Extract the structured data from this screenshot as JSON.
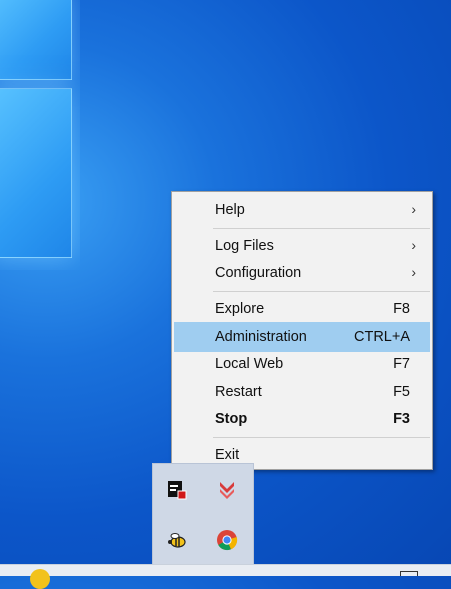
{
  "menu": {
    "items": [
      {
        "label": "Help",
        "shortcut": "",
        "submenu": true
      },
      {
        "label": "Log Files",
        "shortcut": "",
        "submenu": true
      },
      {
        "label": "Configuration",
        "shortcut": "",
        "submenu": true
      },
      {
        "label": "Explore",
        "shortcut": "F8",
        "submenu": false
      },
      {
        "label": "Administration",
        "shortcut": "CTRL+A",
        "submenu": false,
        "highlighted": true
      },
      {
        "label": "Local Web",
        "shortcut": "F7",
        "submenu": false
      },
      {
        "label": "Restart",
        "shortcut": "F5",
        "submenu": false
      },
      {
        "label": "Stop",
        "shortcut": "F3",
        "submenu": false,
        "bold": true
      },
      {
        "label": "Exit",
        "shortcut": "",
        "submenu": false
      }
    ],
    "submenu_glyph": "›"
  },
  "tray": {
    "icons": [
      "server-app-icon",
      "download-arrow-icon",
      "bee-icon",
      "chrome-icon"
    ]
  },
  "colors": {
    "highlight": "#9fcdf0",
    "desktop": "#0c56c9"
  }
}
